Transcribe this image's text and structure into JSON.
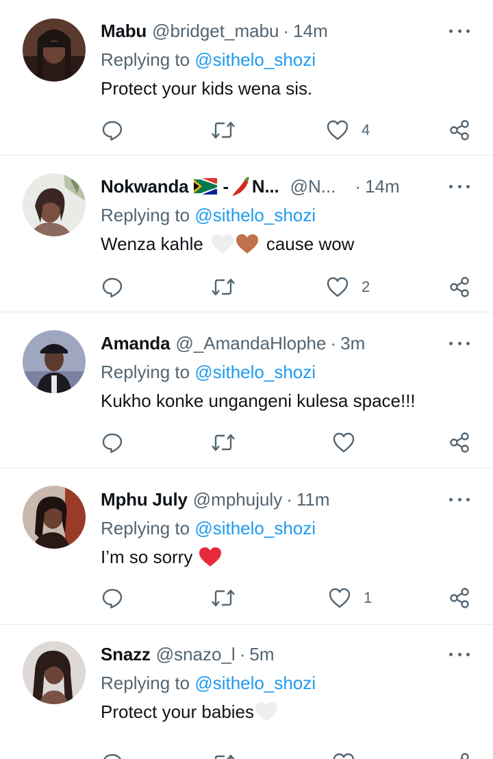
{
  "reply_prefix": "Replying to",
  "tweets": [
    {
      "name": "Mabu",
      "handle": "@bridget_mabu",
      "time": "14m",
      "mention": "@sithelo_shozi",
      "text": "Protect your kids wena sis.",
      "likes": "4"
    },
    {
      "name": "Nokwanda",
      "name_suffix": "- ",
      "name_after_chili": "N...",
      "handle": "@N...",
      "time": "14m",
      "mention": "@sithelo_shozi",
      "text_before": "Wenza kahle",
      "text_after": "cause wow",
      "likes": "2"
    },
    {
      "name": "Amanda",
      "handle": "@_AmandaHlophe",
      "time": "3m",
      "mention": "@sithelo_shozi",
      "text": "Kukho konke ungangeni kulesa space!!!",
      "likes": ""
    },
    {
      "name": "Mphu July",
      "handle": "@mphujuly",
      "time": "11m",
      "mention": "@sithelo_shozi",
      "text": "I’m so sorry",
      "likes": "1"
    },
    {
      "name": "Snazz",
      "handle": "@snazo_l",
      "time": "5m",
      "mention": "@sithelo_shozi",
      "text": "Protect your babies",
      "likes": ""
    }
  ],
  "colors": {
    "primary_text": "#0f1419",
    "secondary_text": "#536471",
    "mention": "#1d9bf0",
    "divider": "#e6e9eb",
    "red_heart": "#e8293b",
    "brown_heart": "#c0704a",
    "white_heart": "#eeeeee"
  },
  "icons": {
    "reply": "speech-bubble-icon",
    "retweet": "retweet-arrows-icon",
    "like": "heart-outline-icon",
    "share": "share-nodes-icon",
    "more": "three-dots-icon",
    "flag": "south-africa-flag-icon",
    "chili": "chili-pepper-icon"
  }
}
